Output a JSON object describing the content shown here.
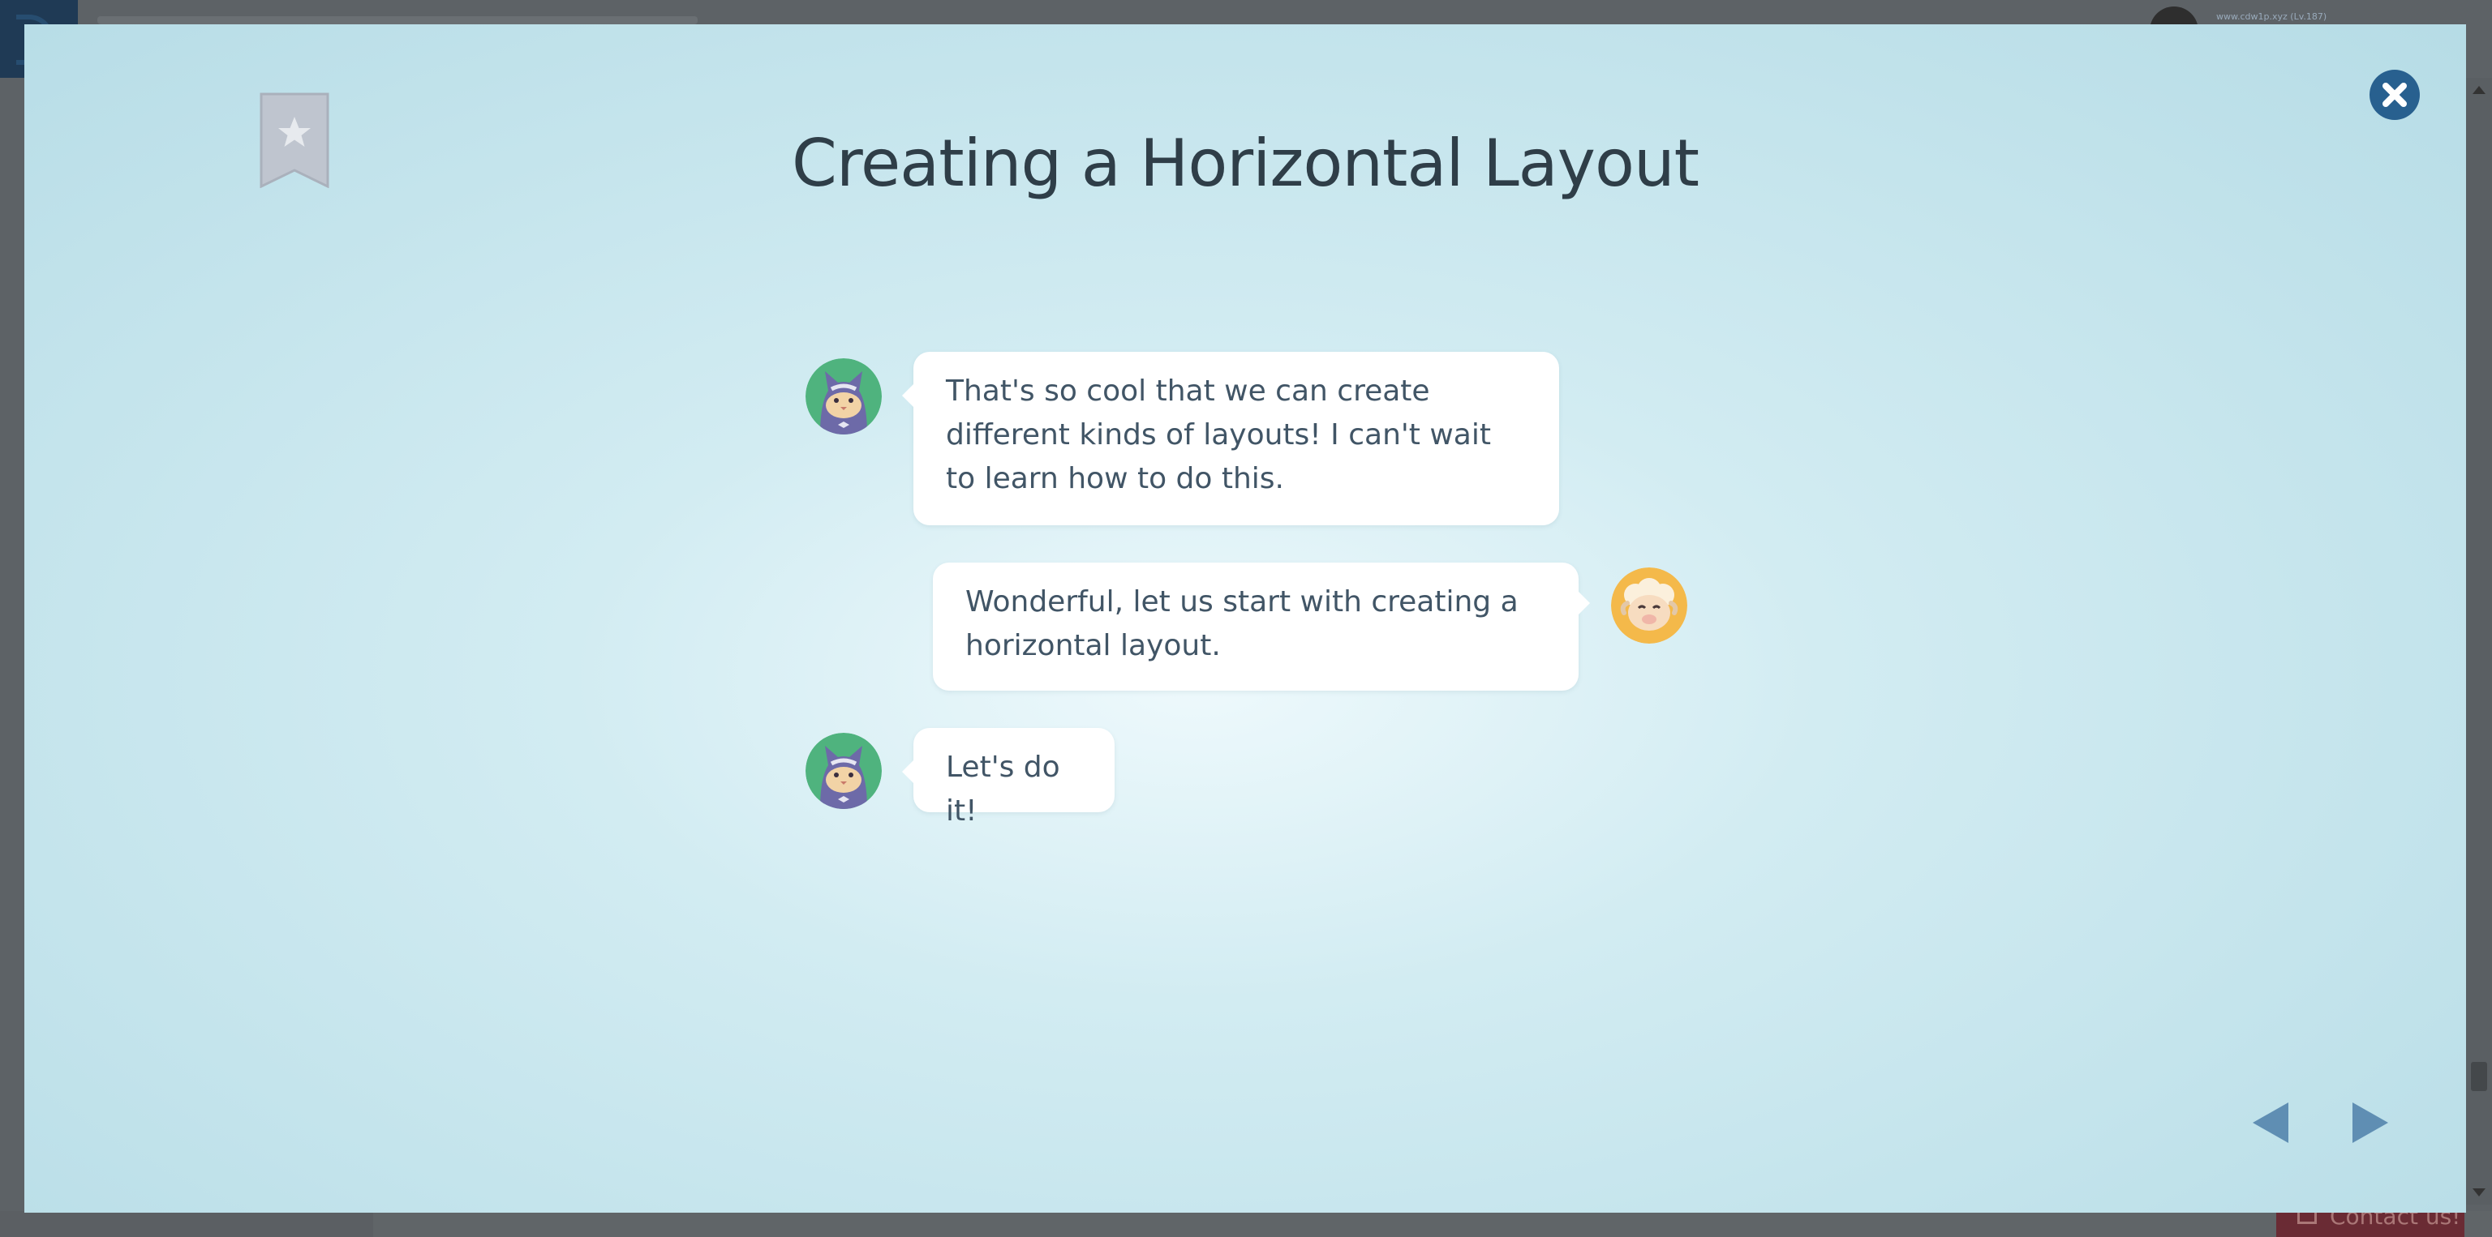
{
  "background_app": {
    "user_text": "www.cdw1p.xyz (Lv.187)",
    "contact_label": "Contact us!"
  },
  "lesson": {
    "title": "Creating a Horizontal Layout",
    "messages": [
      {
        "speaker": "cat",
        "side": "left",
        "text": "That's so cool that we can create different kinds of layouts! I can't wait to learn how to do this."
      },
      {
        "speaker": "sheep",
        "side": "right",
        "text": "Wonderful, let us start with creating a horizontal layout."
      },
      {
        "speaker": "cat",
        "side": "left",
        "text": "Let's do it!"
      }
    ]
  },
  "controls": {
    "bookmark_icon": "bookmark-star-icon",
    "close_icon": "close-icon",
    "prev_icon": "arrow-left-icon",
    "next_icon": "arrow-right-icon"
  },
  "colors": {
    "accent": "#28608f",
    "nav_arrow": "#5f8eb3",
    "bookmark": "#bfc5cf",
    "cat_avatar_bg": "#4fb37e",
    "sheep_avatar_bg": "#f4b94a"
  }
}
